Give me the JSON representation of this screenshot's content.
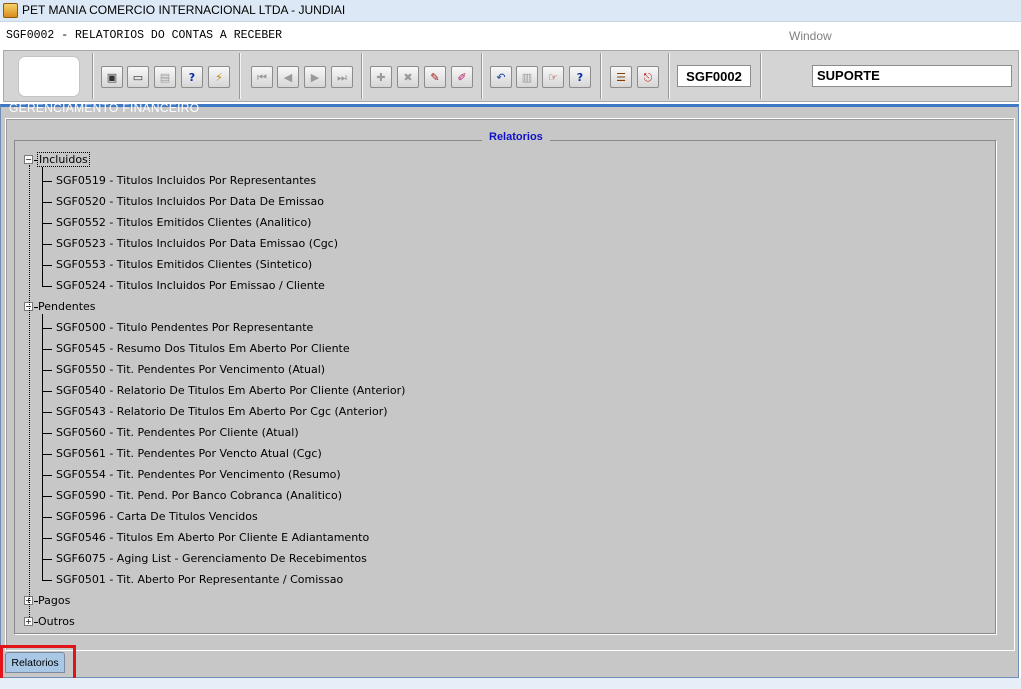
{
  "window": {
    "title": "PET MANIA COMERCIO INTERNACIONAL LTDA - JUNDIAI",
    "form_title": "SGF0002 - RELATORIOS DO CONTAS A RECEBER",
    "menu_window": "Window"
  },
  "toolbar": {
    "screen_code": "SGF0002",
    "user": "SUPORTE"
  },
  "panel": {
    "hidden_title": "GERENCIAMENTO FINANCEIRO",
    "group_title": "Relatorios"
  },
  "tree": {
    "incluidos": {
      "label": "Incluidos",
      "expanded": true,
      "items": [
        "SGF0519 - Titulos Incluidos Por Representantes",
        "SGF0520 - Titulos Incluidos Por Data De Emissao",
        "SGF0552 - Titulos Emitidos Clientes (Analitico)",
        "SGF0523 - Titulos Incluidos Por Data Emissao (Cgc)",
        "SGF0553 - Titulos Emitidos Clientes (Sintetico)",
        "SGF0524 - Titulos Incluidos Por Emissao / Cliente"
      ]
    },
    "pendentes": {
      "label": "Pendentes",
      "expanded": true,
      "items": [
        "SGF0500 - Titulo Pendentes Por Representante",
        "SGF0545 - Resumo Dos Titulos Em Aberto Por Cliente",
        "SGF0550 - Tit. Pendentes Por Vencimento (Atual)",
        "SGF0540 - Relatorio De Titulos Em Aberto Por Cliente (Anterior)",
        "SGF0543 - Relatorio De Titulos Em Aberto Por Cgc (Anterior)",
        "SGF0560 - Tit. Pendentes Por Cliente (Atual)",
        "SGF0561 - Tit. Pendentes Por Vencto Atual (Cgc)",
        "SGF0554 - Tit. Pendentes Por Vencimento (Resumo)",
        "SGF0590 - Tit. Pend. Por Banco Cobranca (Analitico)",
        "SGF0596 - Carta De Titulos Vencidos",
        "SGF0546 - Titulos Em Aberto Por Cliente E Adiantamento",
        "SGF6075 - Aging List - Gerenciamento De Recebimentos",
        "SGF0501 - Tit. Aberto Por Representante / Comissao"
      ]
    },
    "pagos": {
      "label": "Pagos",
      "expanded": false
    },
    "outros": {
      "label": "Outros",
      "expanded": false
    },
    "collapse_glyph": "−",
    "expand_glyph": "+"
  },
  "tabs": [
    {
      "label": "Relatorios",
      "active": true
    }
  ],
  "toolbar_icons": [
    {
      "name": "save-icon",
      "glyph": "▣"
    },
    {
      "name": "screen-icon",
      "glyph": "▭"
    },
    {
      "name": "print-icon",
      "glyph": "▤"
    },
    {
      "name": "query-help-icon",
      "glyph": "?"
    },
    {
      "name": "execute-query-icon",
      "glyph": "⚡"
    },
    {
      "name": "first-record-icon",
      "glyph": "⏮"
    },
    {
      "name": "prev-record-icon",
      "glyph": "◀"
    },
    {
      "name": "next-record-icon",
      "glyph": "▶"
    },
    {
      "name": "last-record-icon",
      "glyph": "⏭"
    },
    {
      "name": "insert-record-icon",
      "glyph": "✚"
    },
    {
      "name": "delete-record-icon",
      "glyph": "✖"
    },
    {
      "name": "edit-record-icon",
      "glyph": "✎"
    },
    {
      "name": "clear-icon",
      "glyph": "✐"
    },
    {
      "name": "undo-icon",
      "glyph": "↶"
    },
    {
      "name": "clipboard-icon",
      "glyph": "▥"
    },
    {
      "name": "hand-icon",
      "glyph": "☞"
    },
    {
      "name": "help-icon",
      "glyph": "?"
    },
    {
      "name": "menu-icon",
      "glyph": "☰"
    },
    {
      "name": "exit-icon",
      "glyph": "⎋"
    }
  ]
}
